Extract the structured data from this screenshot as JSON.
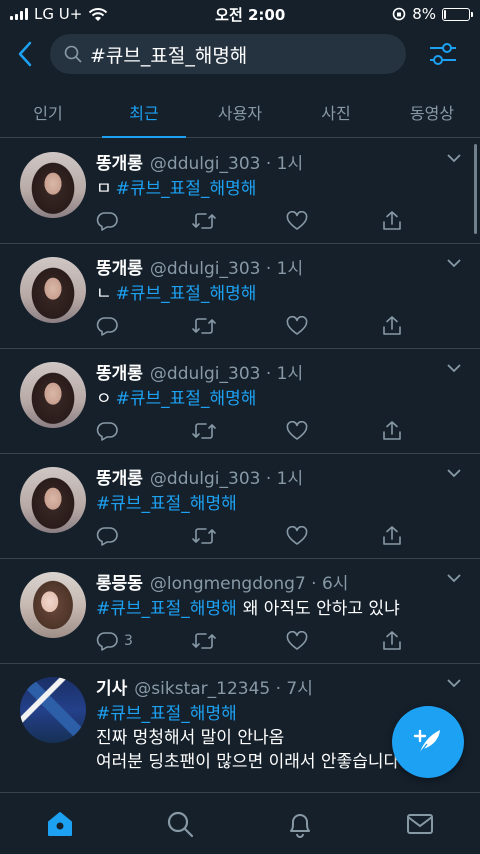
{
  "status": {
    "carrier": "LG U+",
    "time": "오전 2:00",
    "battery": "8%",
    "battery_level": 0.08
  },
  "search": {
    "query": "#큐브_표절_해명해"
  },
  "tabs": [
    {
      "label": "인기"
    },
    {
      "label": "최근",
      "active": true
    },
    {
      "label": "사용자"
    },
    {
      "label": "사진"
    },
    {
      "label": "동영상"
    }
  ],
  "tweets": [
    {
      "name": "똥개롱",
      "handle": "@ddulgi_303 · 1시",
      "prefix": "ㅁ",
      "hashtag": "#큐브_표절_해명해",
      "extra": "",
      "line2": "",
      "line3": "",
      "reply_count": ""
    },
    {
      "name": "똥개롱",
      "handle": "@ddulgi_303 · 1시",
      "prefix": "ㄴ",
      "hashtag": "#큐브_표절_해명해",
      "extra": "",
      "line2": "",
      "line3": "",
      "reply_count": ""
    },
    {
      "name": "똥개롱",
      "handle": "@ddulgi_303 · 1시",
      "prefix": "ㅇ",
      "hashtag": "#큐브_표절_해명해",
      "extra": "",
      "line2": "",
      "line3": "",
      "reply_count": ""
    },
    {
      "name": "똥개롱",
      "handle": "@ddulgi_303 · 1시",
      "prefix": "",
      "hashtag": "#큐브_표절_해명해",
      "extra": "",
      "line2": "",
      "line3": "",
      "reply_count": ""
    },
    {
      "name": "롱믕동",
      "handle": "@longmengdong7 · 6시",
      "prefix": "",
      "hashtag": "#큐브_표절_해명해",
      "extra": "왜 아직도 안하고 있냐",
      "line2": "",
      "line3": "",
      "reply_count": "3"
    },
    {
      "name": "기사",
      "handle": "@sikstar_12345 · 7시",
      "prefix": "",
      "hashtag": "#큐브_표절_해명해",
      "extra": "",
      "line2": "진짜 멍청해서 말이 안나옴",
      "line3": "여러분 딩초팬이 많으면 이래서 안좋습니다",
      "reply_count": ""
    }
  ],
  "colors": {
    "background": "#15202b",
    "accent": "#1da1f2",
    "secondary_text": "#8899a6",
    "divider": "#38444d"
  },
  "icons": {
    "back": "chevron-left-icon",
    "search": "search-icon",
    "filter": "sliders-icon",
    "reply": "comment-icon",
    "retweet": "retweet-icon",
    "like": "heart-icon",
    "share": "share-icon",
    "compose": "feather-plus-icon",
    "nav": [
      "home-icon",
      "search-icon",
      "bell-icon",
      "mail-icon"
    ]
  }
}
